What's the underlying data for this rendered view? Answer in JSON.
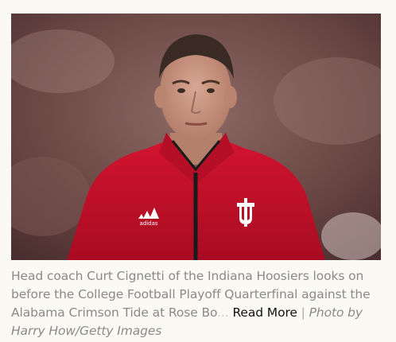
{
  "caption": {
    "text": "Head coach Curt Cignetti of the Indiana Hoosiers looks on before the College Football Playoff Quarterfinal against the Alabama Crimson Tide at Rose Bo",
    "fade_text": "...",
    "read_more_label": "Read More",
    "separator": "|",
    "credit": "Photo by Harry How/Getty Images"
  },
  "photo": {
    "jacket_logo_brand": "adidas",
    "jacket_logo_team": "IU",
    "colors": {
      "jacket_red": "#c8102e",
      "background_dark": "#5b3b3a",
      "skin": "#c99886"
    }
  }
}
